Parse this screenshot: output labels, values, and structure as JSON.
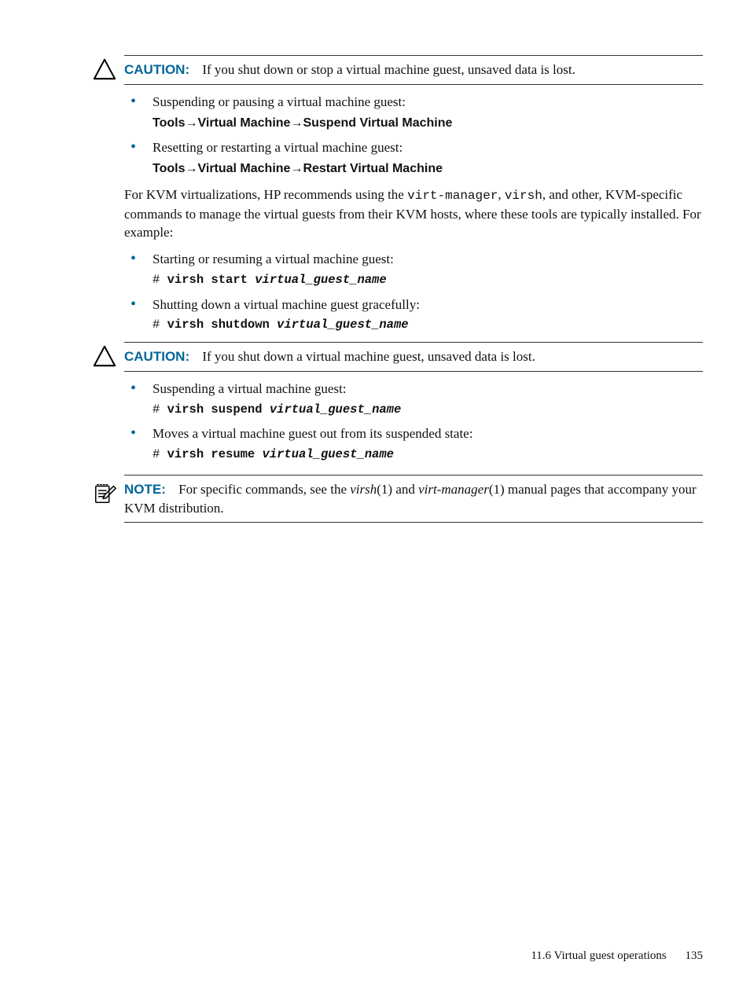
{
  "callout1": {
    "label": "CAUTION:",
    "text": "If you shut down or stop a virtual machine guest, unsaved data is lost."
  },
  "list1": {
    "item1": {
      "text": "Suspending or pausing a virtual machine guest:",
      "path_a": "Tools",
      "path_b": "Virtual Machine",
      "path_c": "Suspend Virtual Machine"
    },
    "item2": {
      "text": "Resetting or restarting a virtual machine guest:",
      "path_a": "Tools",
      "path_b": "Virtual Machine",
      "path_c": "Restart Virtual Machine"
    }
  },
  "para1": {
    "a": "For KVM virtualizations, HP recommends using the ",
    "m1": "virt-manager",
    "b": ", ",
    "m2": "virsh",
    "c": ", and other, KVM-specific commands to manage the virtual guests from their KVM hosts, where these tools are typically installed. For example:"
  },
  "list2": {
    "item1": {
      "text": "Starting or resuming a virtual machine guest:",
      "prompt": "# ",
      "cmd": "virsh start ",
      "arg": "virtual_guest_name"
    },
    "item2": {
      "text": "Shutting down a virtual machine guest gracefully:",
      "prompt": "# ",
      "cmd": "virsh shutdown ",
      "arg": "virtual_guest_name"
    }
  },
  "callout2": {
    "label": "CAUTION:",
    "text": "If you shut down a virtual machine guest, unsaved data is lost."
  },
  "list3": {
    "item1": {
      "text": "Suspending a virtual machine guest:",
      "prompt": "# ",
      "cmd": "virsh suspend ",
      "arg": "virtual_guest_name"
    },
    "item2": {
      "text": "Moves a virtual machine guest out from its suspended state:",
      "prompt": "# ",
      "cmd": "virsh resume ",
      "arg": "virtual_guest_name"
    }
  },
  "note": {
    "label": "NOTE:",
    "a": "For specific commands, see the ",
    "i1": "virsh",
    "b": "(1) and ",
    "i2": "virt-manager",
    "c": "(1) manual pages that accompany your KVM distribution."
  },
  "footer": {
    "section": "11.6 Virtual guest operations",
    "page": "135"
  },
  "arrow": "→"
}
